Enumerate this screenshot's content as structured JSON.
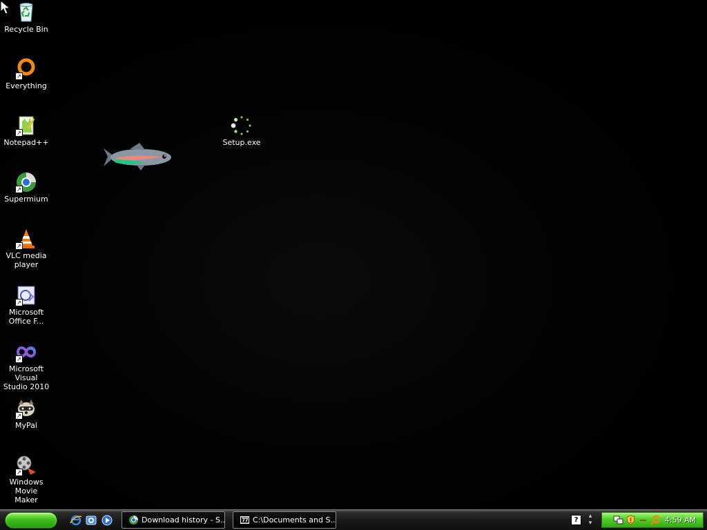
{
  "desktop": {
    "icons": [
      {
        "name": "recycle-bin",
        "label": "Recycle Bin"
      },
      {
        "name": "everything",
        "label": "Everything"
      },
      {
        "name": "notepadpp",
        "label": "Notepad++"
      },
      {
        "name": "supermium",
        "label": "Supermium"
      },
      {
        "name": "vlc",
        "label": "VLC media\nplayer"
      },
      {
        "name": "office-frontpage",
        "label": "Microsoft\nOffice F..."
      },
      {
        "name": "visual-studio",
        "label": "Microsoft Visual\nStudio 2010"
      },
      {
        "name": "mypal",
        "label": "MyPal"
      },
      {
        "name": "movie-maker",
        "label": "Windows Movie\nMaker"
      },
      {
        "name": "setup",
        "label": "Setup.exe"
      }
    ]
  },
  "taskbar": {
    "quick_launch": [
      "ie-icon",
      "show-desktop-icon",
      "media-player-icon"
    ],
    "tasks": [
      {
        "label": "Download history - S..."
      },
      {
        "label": "C:\\Documents and S..."
      }
    ],
    "clock": "4:59 AM"
  },
  "colors": {
    "start_green": "#3fbf1c",
    "tray_green": "#4fcf28",
    "desktop_bg": "#000000"
  }
}
